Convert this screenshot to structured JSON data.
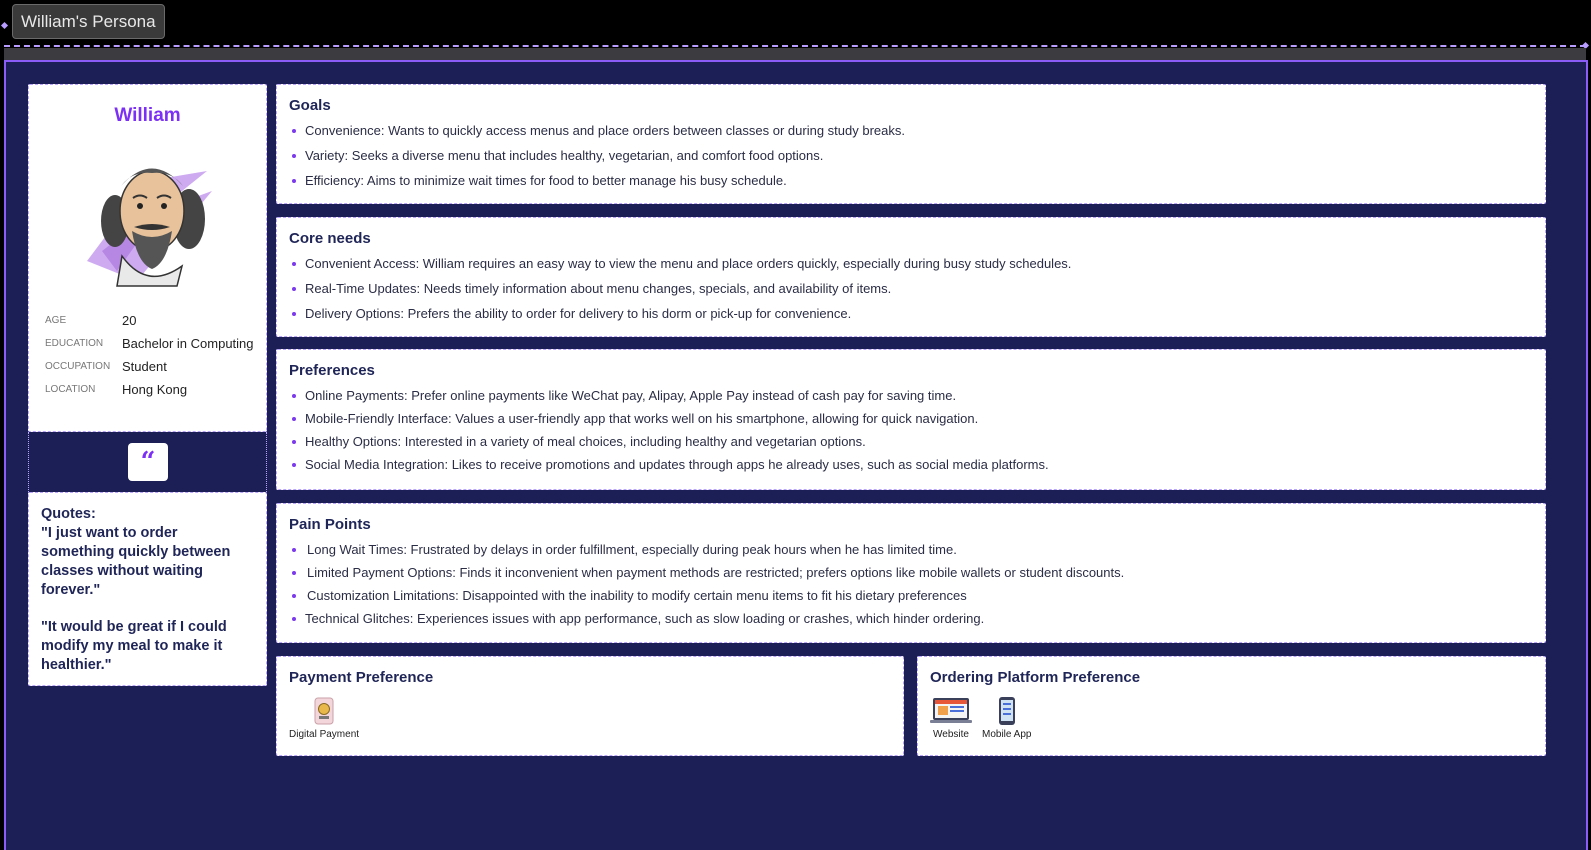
{
  "frame": {
    "title": "William's Persona"
  },
  "profile": {
    "name": "William",
    "fields": [
      {
        "key": "AGE",
        "value": "20"
      },
      {
        "key": "EDUCATION",
        "value": "Bachelor in Computing"
      },
      {
        "key": "OCCUPATION",
        "value": "Student"
      },
      {
        "key": "LOCATION",
        "value": "Hong Kong"
      }
    ]
  },
  "quote_icon": "“",
  "quotes": {
    "heading": "Quotes:",
    "lines": [
      "\"I just want to order something quickly between classes without waiting forever.\"",
      "\"It would be great if I could modify my meal to make it healthier.\""
    ]
  },
  "goals": {
    "title": "Goals",
    "items": [
      "Convenience: Wants to quickly access menus and place orders between classes or during study breaks.",
      "Variety: Seeks a diverse menu that includes healthy, vegetarian, and comfort food options.",
      "Efficiency: Aims to minimize wait times for food to better manage his busy schedule."
    ]
  },
  "core_needs": {
    "title": "Core needs",
    "items": [
      "Convenient Access: William requires an easy way to view the menu and place orders quickly, especially during busy study schedules.",
      "Real-Time Updates: Needs timely information about menu changes, specials, and availability of items.",
      "Delivery Options: Prefers the ability to order for delivery to his dorm or pick-up for convenience."
    ]
  },
  "preferences": {
    "title": "Preferences",
    "items": [
      "Online Payments: Prefer online payments like WeChat pay, Alipay, Apple Pay instead of cash pay for  saving time.",
      "Mobile-Friendly Interface: Values a user-friendly app that works well on his smartphone, allowing for quick navigation.",
      "Healthy Options: Interested in a variety of meal choices, including healthy and vegetarian options.",
      "Social Media Integration: Likes to receive promotions and updates through apps he already uses, such as social media platforms."
    ]
  },
  "pain_points": {
    "title": "Pain Points",
    "items": [
      "Long Wait Times: Frustrated by delays in order fulfillment, especially during peak hours when he has limited time.",
      "Limited Payment Options: Finds it inconvenient when payment methods are restricted; prefers options like mobile wallets or student discounts.",
      "Customization Limitations: Disappointed with the inability to modify certain menu items to fit his dietary preferences",
      "Technical Glitches: Experiences issues with app performance, such as slow loading or crashes, which hinder ordering."
    ]
  },
  "payment_preference": {
    "title": "Payment Preference",
    "items": [
      {
        "icon": "digital-payment-icon",
        "label": "Digital Payment"
      }
    ]
  },
  "platform_preference": {
    "title": "Ordering Platform Preference",
    "items": [
      {
        "icon": "website-icon",
        "label": "Website"
      },
      {
        "icon": "mobile-app-icon",
        "label": "Mobile App"
      }
    ]
  },
  "colors": {
    "canvas": "#1c1f55",
    "accent": "#7c2ff5",
    "selection": "#8b5cf6"
  }
}
